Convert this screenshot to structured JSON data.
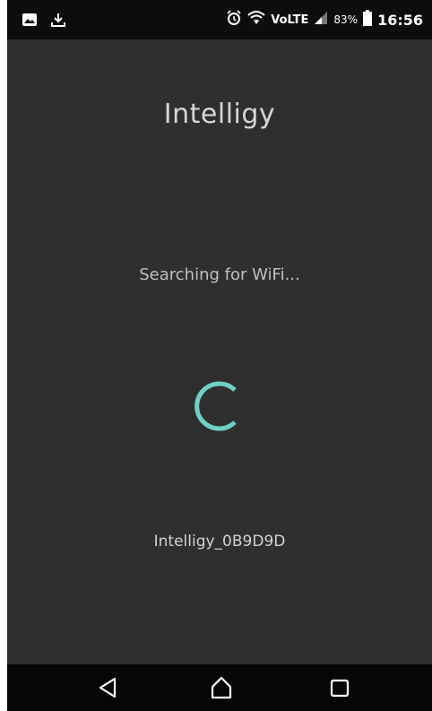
{
  "status_bar": {
    "battery": "83%",
    "time": "16:56",
    "network": "VoLTE",
    "icons": [
      "image-icon",
      "download-icon",
      "alarm-icon",
      "wifi-icon",
      "signal-icon",
      "battery-icon"
    ]
  },
  "app": {
    "title": "Intelligy",
    "status_text": "Searching for WiFi...",
    "device_name": "Intelligy_0B9D9D"
  },
  "colors": {
    "background": "#2f2f2f",
    "status_bar": "#0d0d0d",
    "nav_bar": "#060606",
    "spinner": "#6fd1c6"
  },
  "nav_bar": {
    "icons": [
      "back-icon",
      "home-icon",
      "recents-icon"
    ]
  }
}
